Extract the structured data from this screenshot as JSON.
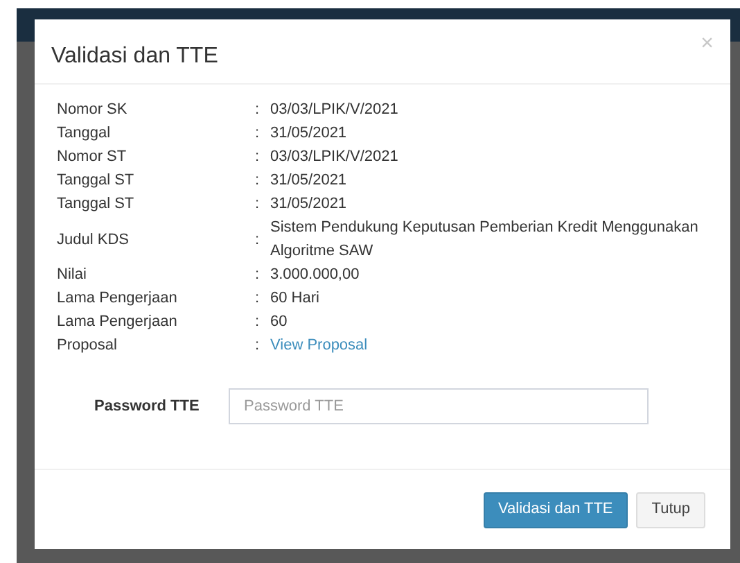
{
  "modal": {
    "title": "Validasi dan TTE",
    "close": "×",
    "rows": [
      {
        "label": "Nomor SK",
        "separator": ":",
        "value": "03/03/LPIK/V/2021",
        "kind": "text"
      },
      {
        "label": "Tanggal",
        "separator": ":",
        "value": "31/05/2021",
        "kind": "text"
      },
      {
        "label": "Nomor ST",
        "separator": ":",
        "value": "03/03/LPIK/V/2021",
        "kind": "text"
      },
      {
        "label": "Tanggal ST",
        "separator": ":",
        "value": "31/05/2021",
        "kind": "text"
      },
      {
        "label": "Tanggal ST",
        "separator": ":",
        "value": "31/05/2021",
        "kind": "text"
      },
      {
        "label": "Judul KDS",
        "separator": ":",
        "value": "Sistem Pendukung Keputusan Pemberian Kredit Menggunakan Algoritme SAW",
        "kind": "text"
      },
      {
        "label": "Nilai",
        "separator": ":",
        "value": "3.000.000,00",
        "kind": "text"
      },
      {
        "label": "Lama Pengerjaan",
        "separator": ":",
        "value": "60 Hari",
        "kind": "text"
      },
      {
        "label": "Lama Pengerjaan",
        "separator": ":",
        "value": "60",
        "kind": "text"
      },
      {
        "label": "Proposal",
        "separator": ":",
        "value": "View Proposal",
        "kind": "link"
      }
    ],
    "password": {
      "label": "Password TTE",
      "placeholder": "Password TTE"
    },
    "buttons": [
      {
        "label": "Validasi dan TTE",
        "kind": "primary"
      },
      {
        "label": "Tutup",
        "kind": "default"
      }
    ]
  }
}
